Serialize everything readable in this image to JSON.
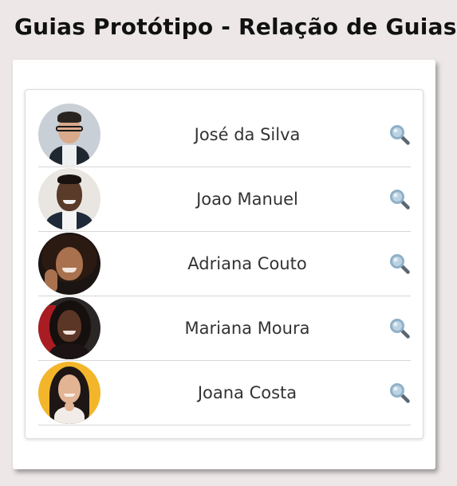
{
  "page": {
    "title": "Guias Protótipo - Relação de Guias"
  },
  "guides": [
    {
      "name": "José da Silva",
      "avatar": "avatar-man-glasses",
      "icon": "search-icon"
    },
    {
      "name": "Joao Manuel",
      "avatar": "avatar-man-smiling",
      "icon": "search-icon"
    },
    {
      "name": "Adriana Couto",
      "avatar": "avatar-woman-curly-hair",
      "icon": "search-icon"
    },
    {
      "name": "Mariana Moura",
      "avatar": "avatar-woman-red-background",
      "icon": "search-icon"
    },
    {
      "name": "Joana Costa",
      "avatar": "avatar-woman-yellow-background",
      "icon": "search-icon"
    }
  ],
  "colors": {
    "page_background": "#ede7e7",
    "card_background": "#ffffff",
    "divider": "#d6d6d6",
    "search_icon_lens": "#8fb0c8",
    "search_icon_handle": "#5a6670"
  }
}
